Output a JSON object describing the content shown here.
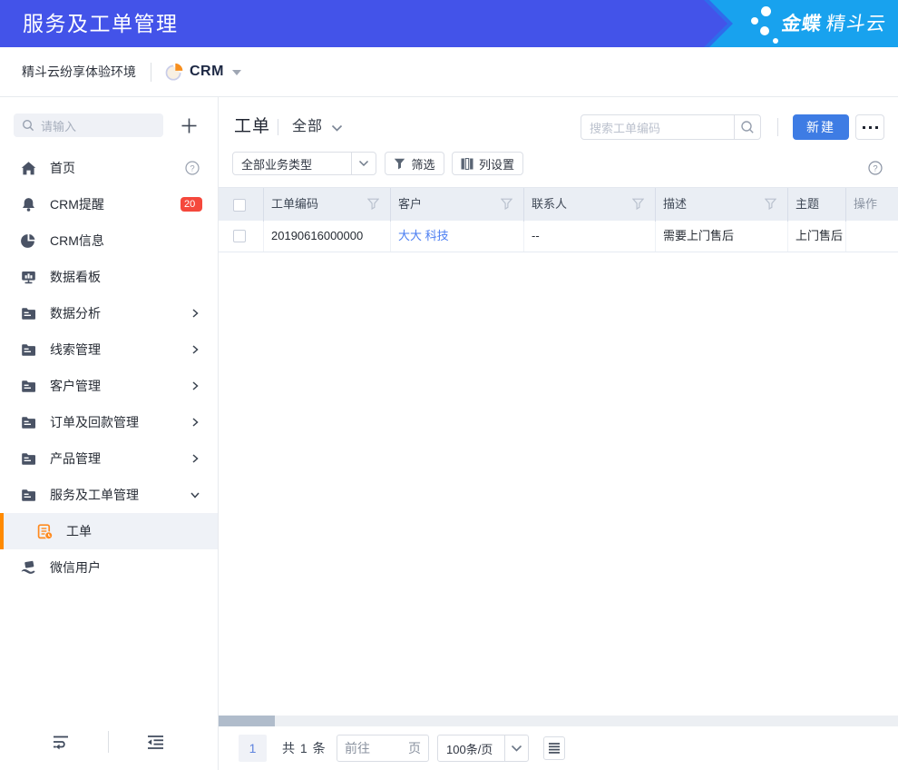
{
  "header": {
    "title": "服务及工单管理",
    "logo_bold": "金蝶",
    "logo_light": "精斗云"
  },
  "subheader": {
    "env_name": "精斗云纷享体验环境",
    "app_name": "CRM"
  },
  "sidebar": {
    "search_placeholder": "请输入",
    "menu": [
      {
        "label": "首页",
        "icon": "home-icon"
      },
      {
        "label": "CRM提醒",
        "icon": "bell-icon",
        "badge": "20"
      },
      {
        "label": "CRM信息",
        "icon": "pie-icon"
      },
      {
        "label": "数据看板",
        "icon": "dashboard-icon"
      },
      {
        "label": "数据分析",
        "icon": "folder-icon"
      },
      {
        "label": "线索管理",
        "icon": "folder-icon"
      },
      {
        "label": "客户管理",
        "icon": "folder-icon"
      },
      {
        "label": "订单及回款管理",
        "icon": "folder-icon"
      },
      {
        "label": "产品管理",
        "icon": "folder-icon"
      },
      {
        "label": "服务及工单管理",
        "icon": "folder-icon"
      },
      {
        "label": "工单",
        "icon": "ticket-icon",
        "active": true
      },
      {
        "label": "微信用户",
        "icon": "wechat-user-icon"
      }
    ]
  },
  "toolbar": {
    "page_title": "工单",
    "scope_label": "全部",
    "search_placeholder": "搜索工单编码",
    "create_label": "新建",
    "more_label": "···"
  },
  "filterbar": {
    "type_select_value": "全部业务类型",
    "filter_label": "筛选",
    "columns_label": "列设置"
  },
  "table": {
    "columns": [
      {
        "label": ""
      },
      {
        "label": "工单编码",
        "filter": true
      },
      {
        "label": "客户",
        "filter": true
      },
      {
        "label": "联系人",
        "filter": true
      },
      {
        "label": "描述",
        "filter": true
      },
      {
        "label": "主题",
        "filter": false
      },
      {
        "label": "操作",
        "filter": false
      }
    ],
    "rows": [
      {
        "code": "20190616000000",
        "customer": "大大 科技",
        "contact": "--",
        "description": "需要上门售后",
        "subject": "上门售后",
        "action": ""
      }
    ]
  },
  "pagination": {
    "current_page": "1",
    "total_text": "共 1 条",
    "goto_prefix": "前往",
    "goto_suffix": "页",
    "page_size": "100条/页"
  },
  "colors": {
    "topbar_blue": "#4353e9",
    "logo_sky_blue": "#18a2ee",
    "accent_orange": "#ff8a00",
    "badge_red": "#f5483c",
    "link_blue": "#4a7df2",
    "create_button_blue": "#3e7ce4"
  }
}
